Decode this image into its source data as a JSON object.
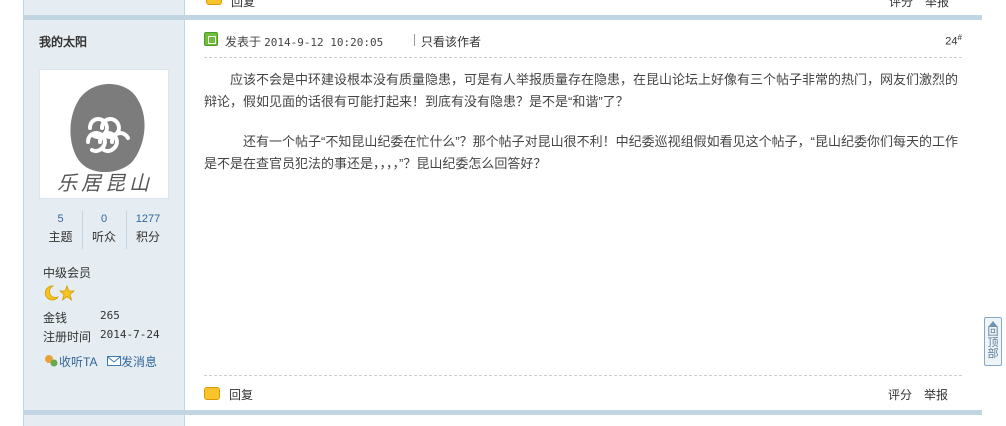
{
  "prev_post": {
    "reply_label": "回复",
    "rate_label": "评分",
    "report_label": "举报"
  },
  "author": {
    "username": "我的太阳",
    "avatar_caption": "乐居昆山",
    "stats": [
      {
        "value": "5",
        "label": "主题"
      },
      {
        "value": "0",
        "label": "听众"
      },
      {
        "value": "1277",
        "label": "积分"
      }
    ],
    "group": "中级会员",
    "money_label": "金钱",
    "money_value": "265",
    "reg_label": "注册时间",
    "reg_value": "2014-7-24",
    "follow_label": "收听TA",
    "message_label": "发消息"
  },
  "post": {
    "posted_label": "发表于",
    "posted_time": "2014-9-12 10:20:05",
    "author_only_label": "只看该作者",
    "floor_number": "24",
    "floor_suffix": "#",
    "paragraphs": [
      "应该不会是中环建设根本没有质量隐患，可是有人举报质量存在隐患，在昆山论坛上好像有三个帖子非常的热门，网友们激烈的辩论，假如见面的话很有可能打起来！到底有没有隐患？是不是“和谐”了？",
      "还有一个帖子“不知昆山纪委在忙什么”？那个帖子对昆山很不利！中纪委巡视组假如看见这个帖子，“昆山纪委你们每天的工作是不是在查官员犯法的事还是，，，，”？昆山纪委怎么回答好？"
    ],
    "reply_label": "回复",
    "rate_label": "评分",
    "report_label": "举报"
  },
  "back_to_top_label": "回顶部",
  "colors": {
    "sidebar_bg": "#e5edf2",
    "separator": "#c2d5e3",
    "link_blue": "#336699"
  }
}
